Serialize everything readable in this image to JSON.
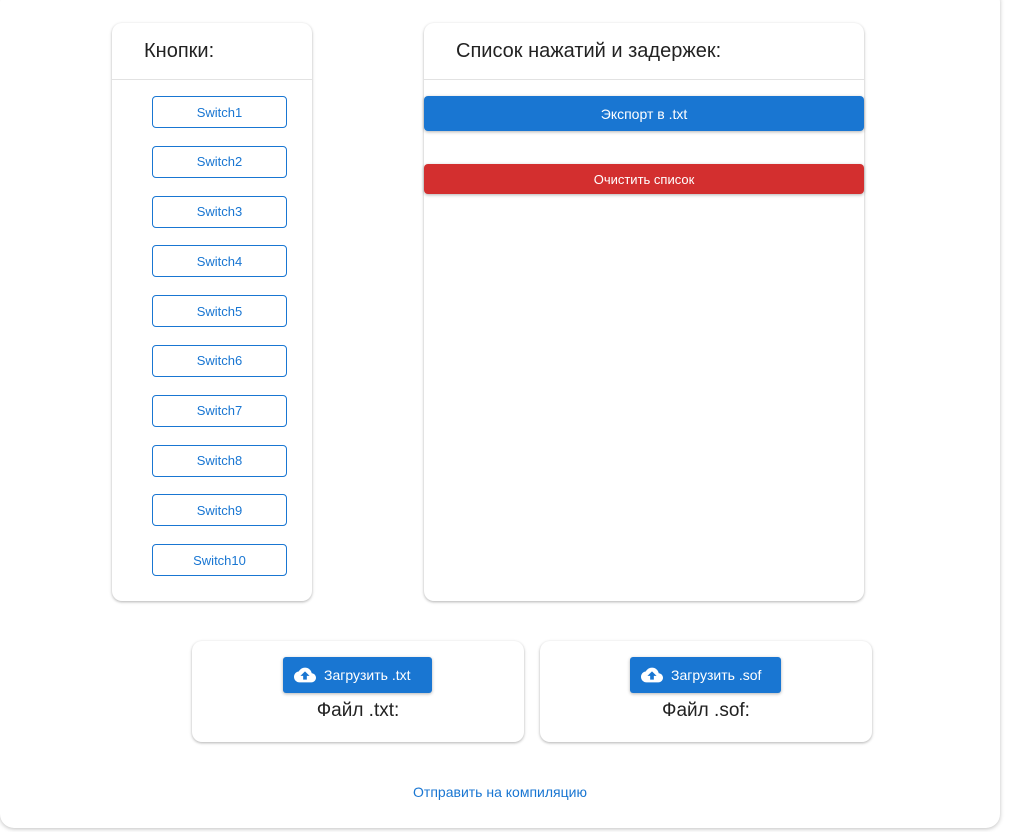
{
  "buttons_panel": {
    "title": "Кнопки:",
    "switches": [
      "Switch1",
      "Switch2",
      "Switch3",
      "Switch4",
      "Switch5",
      "Switch6",
      "Switch7",
      "Switch8",
      "Switch9",
      "Switch10"
    ]
  },
  "log_panel": {
    "title": "Список нажатий и задержек:",
    "export_label": "Экспорт в .txt",
    "clear_label": "Очистить список"
  },
  "upload_txt": {
    "button_label": "Загрузить .txt",
    "icon": "cloud-upload-icon",
    "file_label": "Файл .txt:"
  },
  "upload_sof": {
    "button_label": "Загрузить .sof",
    "icon": "cloud-upload-icon",
    "file_label": "Файл .sof:"
  },
  "footer": {
    "compile_link": "Отправить на компиляцию"
  },
  "colors": {
    "primary": "#1976d2",
    "danger": "#d32f2f",
    "text": "#222222"
  }
}
